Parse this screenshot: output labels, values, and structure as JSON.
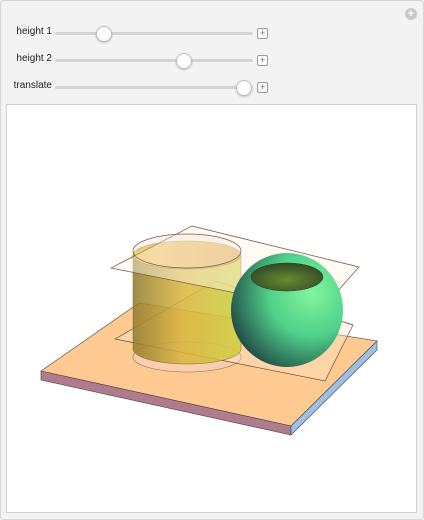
{
  "controls": {
    "sliders": [
      {
        "label": "height 1",
        "value": 0.25,
        "expand_icon": "plus-icon"
      },
      {
        "label": "height 2",
        "value": 0.65,
        "expand_icon": "plus-icon"
      },
      {
        "label": "translate",
        "value": 0.95,
        "expand_icon": "plus-icon"
      }
    ],
    "options_icon": "plus-circle-icon"
  },
  "scene": {
    "base_plate_color": "#ffc992",
    "cylinder_colors": [
      "#f2c83d",
      "#c7c94a"
    ],
    "sphere_colors": [
      "#7cf59a",
      "#1f3c3e"
    ],
    "plane_color": "#fff3e6"
  }
}
